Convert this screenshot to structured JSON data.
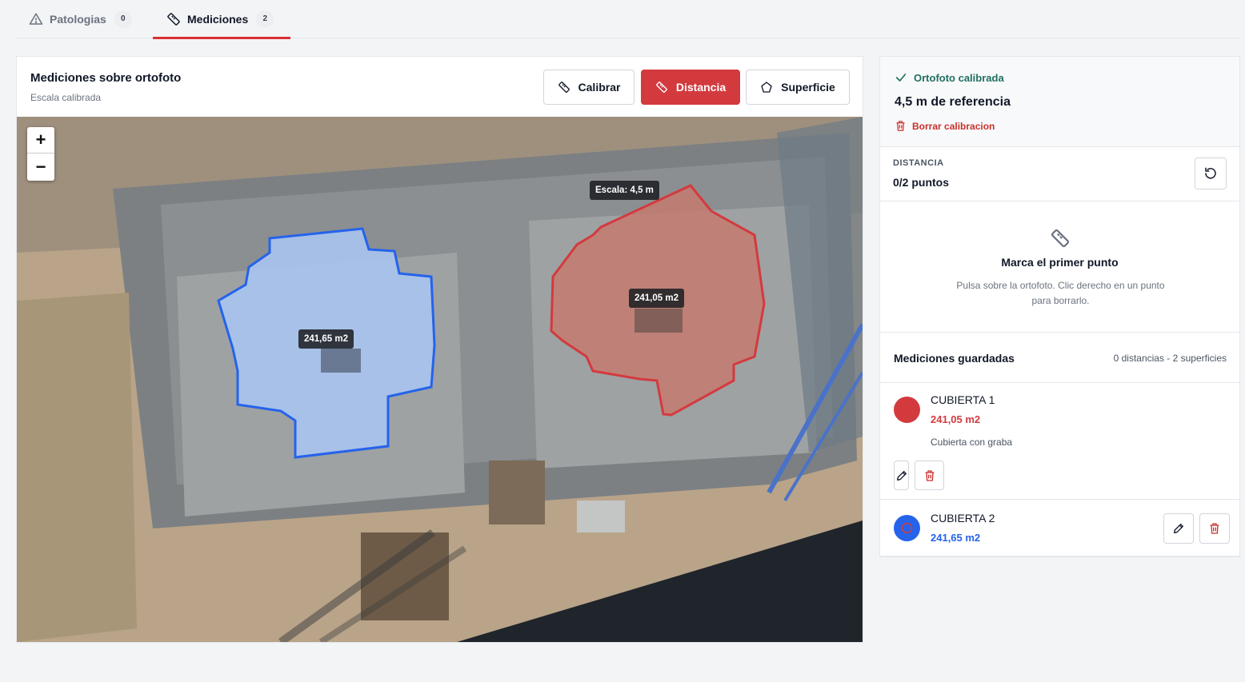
{
  "tabs": [
    {
      "label": "Patologias",
      "count": "0",
      "icon": "warning-icon"
    },
    {
      "label": "Mediciones",
      "count": "2",
      "icon": "ruler-icon"
    }
  ],
  "card": {
    "title": "Mediciones sobre ortofoto",
    "subtitle": "Escala calibrada",
    "tools": {
      "calibrar": "Calibrar",
      "distancia": "Distancia",
      "superficie": "Superficie"
    }
  },
  "map": {
    "zoom_in": "+",
    "zoom_out": "−",
    "scale_label": "Escala: 4,5 m",
    "area_red_label": "241,05 m2",
    "area_blue_label": "241,65 m2"
  },
  "calibration": {
    "status": "Ortofoto calibrada",
    "reference": "4,5 m de referencia",
    "delete_label": "Borrar calibracion"
  },
  "distance": {
    "label": "DISTANCIA",
    "points": "0/2 puntos"
  },
  "empty_state": {
    "title": "Marca el primer punto",
    "description": "Pulsa sobre la ortofoto. Clic derecho en un punto para borrarlo."
  },
  "saved": {
    "title": "Mediciones guardadas",
    "count": "0 distancias - 2 superficies",
    "items": [
      {
        "name": "CUBIERTA 1",
        "area": "241,05 m2",
        "description": "Cubierta con graba",
        "color": "#d33a3e"
      },
      {
        "name": "CUBIERTA 2",
        "area": "241,65 m2",
        "color": "#2563eb"
      }
    ]
  },
  "colors": {
    "accent": "#d33a3e",
    "success": "#1f6f62",
    "blue": "#2563eb"
  }
}
